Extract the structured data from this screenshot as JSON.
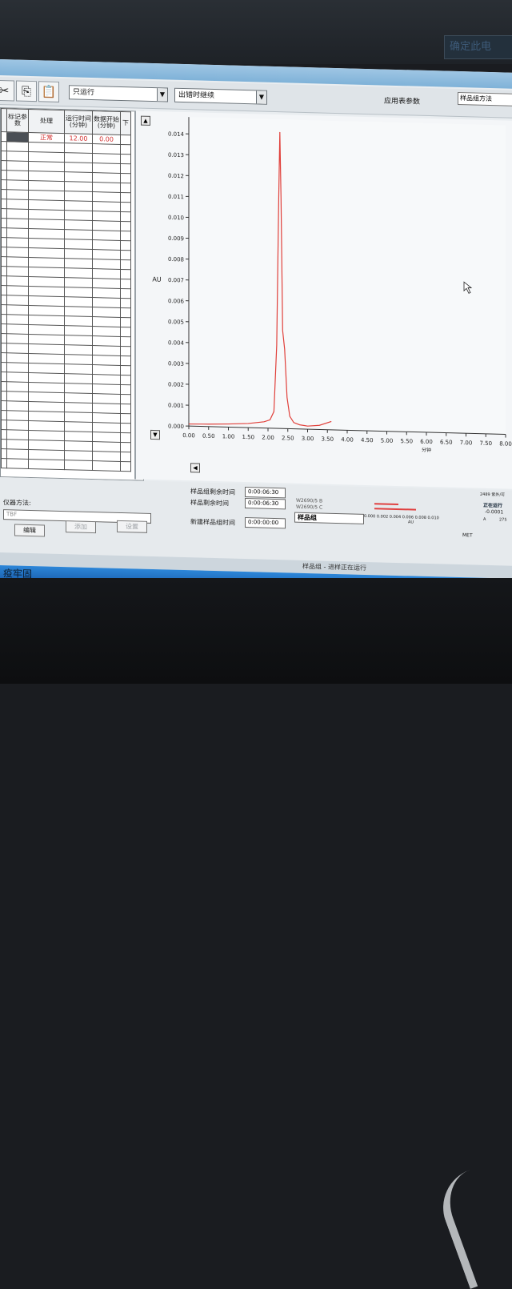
{
  "bezel": {
    "corner_text": "确定此电"
  },
  "toolbar": {
    "mode_select": "只运行",
    "error_select": "出错时继续",
    "table_params_label": "应用表参数",
    "method_box": "样品组方法"
  },
  "table": {
    "headers": [
      "标记参数",
      "处理",
      "运行时间(分钟)",
      "数据开始(分钟)",
      "下"
    ],
    "first_row": {
      "process": "正常",
      "run_time": "12.00",
      "data_start": "0.00"
    }
  },
  "chart_data": {
    "type": "line",
    "title": "",
    "xlabel": "分钟",
    "ylabel": "AU",
    "xlim": [
      0,
      8.0
    ],
    "ylim": [
      0,
      0.0145
    ],
    "x_ticks": [
      "0.00",
      "0.50",
      "1.00",
      "1.50",
      "2.00",
      "2.50",
      "3.00",
      "3.50",
      "4.00",
      "4.50",
      "5.00",
      "5.50",
      "6.00",
      "6.50",
      "7.00",
      "7.50",
      "8.00"
    ],
    "y_ticks": [
      "0.000",
      "0.001",
      "0.002",
      "0.003",
      "0.004",
      "0.005",
      "0.006",
      "0.007",
      "0.008",
      "0.009",
      "0.010",
      "0.011",
      "0.012",
      "0.013",
      "0.014"
    ],
    "series": [
      {
        "color": "#e0403a",
        "x": [
          0.0,
          0.5,
          1.0,
          1.5,
          1.9,
          2.05,
          2.15,
          2.22,
          2.27,
          2.3,
          2.33,
          2.37,
          2.42,
          2.48,
          2.55,
          2.65,
          2.8,
          3.0,
          3.3,
          3.6
        ],
        "y": [
          0.0001,
          0.00012,
          0.00015,
          0.0002,
          0.0003,
          0.0004,
          0.0008,
          0.004,
          0.011,
          0.0142,
          0.011,
          0.0047,
          0.0038,
          0.0015,
          0.0006,
          0.0003,
          0.0002,
          0.00015,
          0.0002,
          0.0004
        ]
      }
    ]
  },
  "status": {
    "remaining_label": "样品组剩余时间",
    "remaining_value": "0:00:06:30",
    "sample_remaining_label": "样品剩余时间",
    "sample_remaining_value": "0:00:06:30",
    "new_label": "新建样品组时间",
    "new_value": "0:00:00:00",
    "instrument_method_label": "仪器方法:",
    "instrument_method_value": "TBF",
    "edit_button": "编辑",
    "add_button": "添加",
    "delete_button": "设置",
    "list_item_1": "W2690/5 B",
    "list_item_2": "W2690/5 C",
    "sample_group_label": "样品组",
    "mini_ticks": "0.000 0.002 0.004 0.006 0.008 0.010",
    "mini_axis": "AU",
    "right_header": "2489 紫外/可",
    "running_label": "正在运行",
    "value_a": "-0.0001",
    "value_a_label": "A",
    "value_wl": "275",
    "met_label": "MET",
    "statusbar_text": "样品组 - 进样正在运行"
  },
  "taskbar": {
    "text": "疫牢固"
  }
}
